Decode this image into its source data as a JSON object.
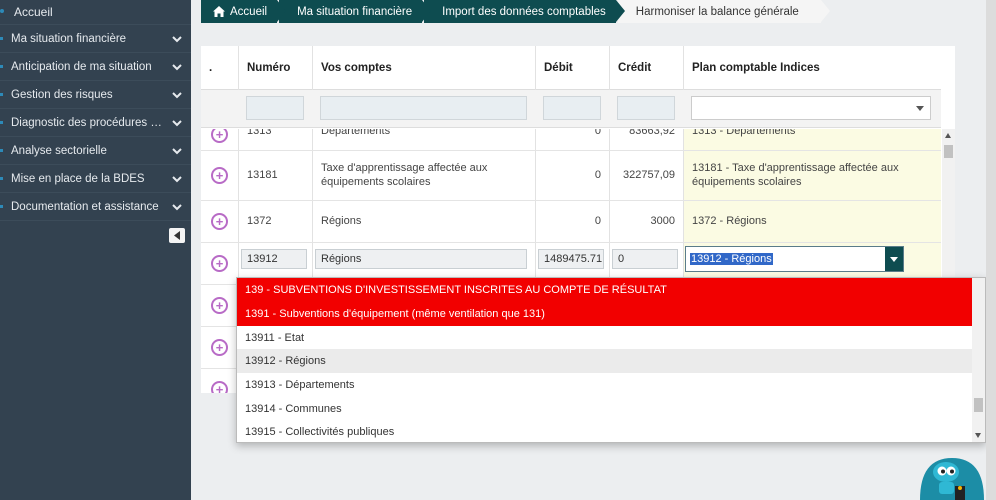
{
  "sidebar": {
    "home_label": "Accueil",
    "items": [
      {
        "label": "Ma situation financière"
      },
      {
        "label": "Anticipation de ma situation"
      },
      {
        "label": "Gestion des risques"
      },
      {
        "label": "Diagnostic des procédures de ..."
      },
      {
        "label": "Analyse sectorielle"
      },
      {
        "label": "Mise en place de la BDES"
      },
      {
        "label": "Documentation et assistance"
      }
    ]
  },
  "breadcrumb": [
    {
      "label": "Accueil",
      "icon": "home-icon"
    },
    {
      "label": "Ma situation financière"
    },
    {
      "label": "Import des données comptables"
    },
    {
      "label": "Harmoniser la balance générale"
    }
  ],
  "table": {
    "headers": {
      "dot": ".",
      "numero": "Numéro",
      "comptes": "Vos comptes",
      "debit": "Débit",
      "credit": "Crédit",
      "plan": "Plan comptable Indices"
    },
    "rows": [
      {
        "numero": "1313",
        "compte": "Départements",
        "debit": "0",
        "credit": "83663,92",
        "plan": "1313 - Départements"
      },
      {
        "numero": "13181",
        "compte": "Taxe d'apprentissage affectée aux équipements scolaires",
        "debit": "0",
        "credit": "322757,09",
        "plan": "13181 - Taxe d'apprentissage affectée aux équipements scolaires"
      },
      {
        "numero": "1372",
        "compte": "Régions",
        "debit": "0",
        "credit": "3000",
        "plan": "1372 - Régions"
      }
    ],
    "edit_row": {
      "numero": "13912",
      "compte": "Régions",
      "debit": "1489475.71",
      "credit": "0",
      "plan": "13912 - Régions"
    }
  },
  "dropdown": {
    "options": [
      {
        "label": "139 - SUBVENTIONS D'INVESTISSEMENT INSCRITES AU COMPTE DE RÉSULTAT",
        "style": "red"
      },
      {
        "label": "1391 - Subventions d'équipement (même ventilation que 131)",
        "style": "red"
      },
      {
        "label": "13911 - Etat",
        "style": "normal"
      },
      {
        "label": "13912 - Régions",
        "style": "highlight"
      },
      {
        "label": "13913 - Départements",
        "style": "normal"
      },
      {
        "label": "13914 - Communes",
        "style": "normal"
      },
      {
        "label": "13915 - Collectivités publiques",
        "style": "normal"
      }
    ]
  },
  "colors": {
    "sidebar_bg": "#334250",
    "breadcrumb_bg": "#0e4c50",
    "plus_icon": "#b86bc6",
    "red_option": "#f20000",
    "plan_cell_bg": "#fbfbe3"
  }
}
